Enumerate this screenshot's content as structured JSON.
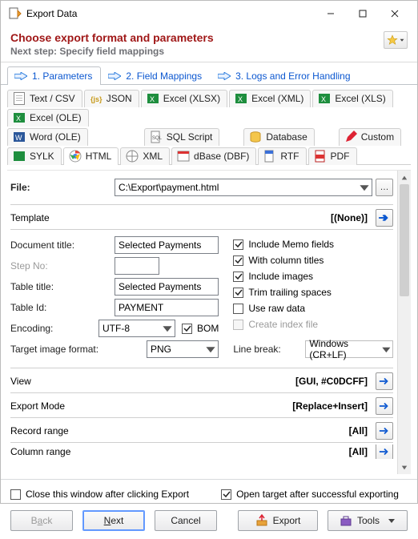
{
  "window": {
    "title": "Export Data"
  },
  "header": {
    "title": "Choose export format and parameters",
    "subtitle": "Next step: Specify field mappings"
  },
  "steps": {
    "items": [
      {
        "label": "1. Parameters"
      },
      {
        "label": "2. Field Mappings"
      },
      {
        "label": "3. Logs and Error Handling"
      }
    ]
  },
  "formats": {
    "row1": [
      {
        "label": "Text / CSV"
      },
      {
        "label": "JSON"
      },
      {
        "label": "Excel (XLSX)"
      },
      {
        "label": "Excel (XML)"
      },
      {
        "label": "Excel (XLS)"
      },
      {
        "label": "Excel (OLE)"
      }
    ],
    "row2": [
      {
        "label": "Word (OLE)"
      },
      {
        "label": "SQL Script"
      },
      {
        "label": "Database"
      },
      {
        "label": "Custom"
      }
    ],
    "row3": [
      {
        "label": "SYLK"
      },
      {
        "label": "HTML"
      },
      {
        "label": "XML"
      },
      {
        "label": "dBase (DBF)"
      },
      {
        "label": "RTF"
      },
      {
        "label": "PDF"
      }
    ]
  },
  "params": {
    "file_label": "File:",
    "file_value": "C:\\Export\\payment.html",
    "template_label": "Template",
    "template_value": "[(None)]",
    "doc_title_label": "Document title:",
    "doc_title_value": "Selected Payments",
    "step_no_label": "Step No:",
    "step_no_value": "",
    "table_title_label": "Table title:",
    "table_title_value": "Selected Payments",
    "table_id_label": "Table Id:",
    "table_id_value": "PAYMENT",
    "encoding_label": "Encoding:",
    "encoding_value": "UTF-8",
    "bom_label": "BOM",
    "target_img_label": "Target image format:",
    "target_img_value": "PNG",
    "chk_memo": "Include Memo fields",
    "chk_coltitles": "With column titles",
    "chk_images": "Include images",
    "chk_trim": "Trim trailing spaces",
    "chk_raw": "Use raw data",
    "chk_index": "Create index file",
    "linebreak_label": "Line break:",
    "linebreak_value": "Windows (CR+LF)",
    "sect_view_label": "View",
    "sect_view_value": "[GUI, #C0DCFF]",
    "sect_mode_label": "Export Mode",
    "sect_mode_value": "[Replace+Insert]",
    "sect_rec_label": "Record range",
    "sect_rec_value": "[All]",
    "sect_col_label": "Column range",
    "sect_col_value": "[All]"
  },
  "footer": {
    "close_after": "Close this window after clicking Export",
    "open_after": "Open target after successful exporting",
    "back_pre": "B",
    "back_u": "a",
    "back_post": "ck",
    "next_u": "N",
    "next_post": "ext",
    "cancel": "Cancel",
    "export": "Export",
    "tools": "Tools"
  }
}
